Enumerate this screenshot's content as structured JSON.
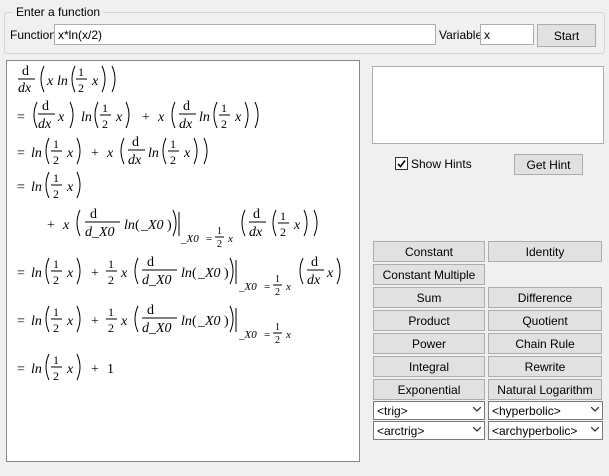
{
  "input": {
    "group_title": "Enter a function",
    "function_label": "Function",
    "function_value": "x*ln(x/2)",
    "variable_label": "Variable",
    "variable_value": "x",
    "start_label": "Start"
  },
  "math": {
    "d": "d",
    "dx": "dx",
    "d_x0": "d_X0",
    "x": "x",
    "ln": "ln",
    "x0": "_X0",
    "one": "1",
    "two": "2",
    "eq": "=",
    "plus": "+",
    "sub_x0": "_X0",
    "sub_eq": "="
  },
  "hints": {
    "show_hints_label": "Show Hints",
    "show_hints_checked": true,
    "get_hint_label": "Get Hint"
  },
  "rules": {
    "constant": "Constant",
    "identity": "Identity",
    "constant_multiple": "Constant Multiple",
    "sum": "Sum",
    "difference": "Difference",
    "product": "Product",
    "quotient": "Quotient",
    "power": "Power",
    "chain_rule": "Chain Rule",
    "integral": "Integral",
    "rewrite": "Rewrite",
    "exponential": "Exponential",
    "natural_logarithm": "Natural Logarithm"
  },
  "dropdowns": {
    "trig": "<trig>",
    "hyperbolic": "<hyperbolic>",
    "arctrig": "<arctrig>",
    "archyperbolic": "<archyperbolic>"
  },
  "colors": {
    "accent": "#0078d7",
    "button": "#e1e1e1",
    "panel_border": "#828790"
  }
}
